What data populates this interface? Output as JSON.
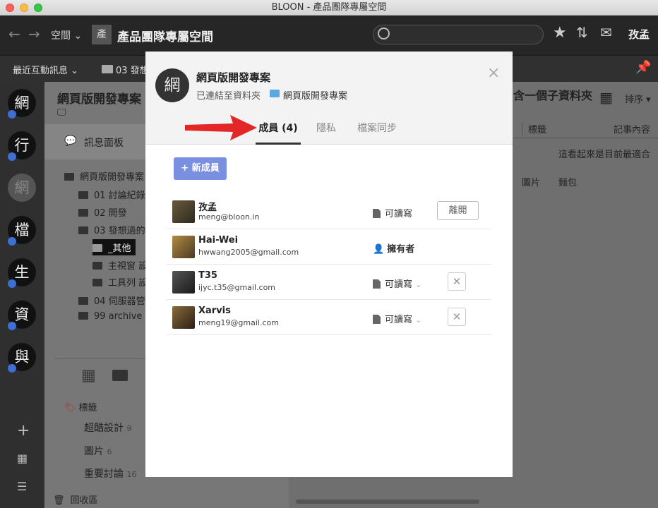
{
  "window": {
    "title": "BLOON - 產品團隊專屬空間"
  },
  "toolbar": {
    "space_label": "空間",
    "space_icon_char": "產",
    "space_name": "產品團隊專屬空間",
    "user": "孜孟"
  },
  "subbar": {
    "recent": "最近互動訊息",
    "folder_crumb": "03 發想"
  },
  "rail": {
    "avatars": [
      "網",
      "行",
      "網",
      "檔",
      "生",
      "資",
      "與"
    ]
  },
  "sidebar": {
    "message_board": "訊息面板",
    "project_title": "網頁版開發專案",
    "tree": [
      "網頁版開發專案",
      "01 討論紀錄",
      "02 開發",
      "03 發想過的",
      "_其他",
      "主視窗 設",
      "工具列 設",
      "04 伺服器管",
      "99 archive"
    ],
    "tags_header": "標籤",
    "tags": [
      {
        "name": "超酷設計",
        "count": "9"
      },
      {
        "name": "圖片",
        "count": "6"
      },
      {
        "name": "重要討論",
        "count": "16"
      }
    ],
    "trash": "回收區"
  },
  "main": {
    "header_partial": "含一個子資料夾",
    "sort_label": "排序",
    "col_tag": "標籤",
    "col_content": "記事內容",
    "row1_content": "這看起來是目前最適合",
    "row2_tag": "圖片",
    "row2_content": "麵包"
  },
  "modal": {
    "avatar_char": "網",
    "title": "網頁版開發專案",
    "linked_label": "已連結至資料夾",
    "linked_folder": "網頁版開發專案",
    "close_icon": "×",
    "tabs": {
      "members": "成員 (4)",
      "privacy": "隱私",
      "sync": "檔案同步"
    },
    "add_member": "+ 新成員",
    "members": [
      {
        "name": "孜孟",
        "email": "meng@bloon.in",
        "perm": "可讀寫",
        "action": "離開"
      },
      {
        "name": "Hai-Wei",
        "email": "hwwang2005@gmail.com",
        "perm": "擁有者"
      },
      {
        "name": "T35",
        "email": "ijyc.t35@gmail.com",
        "perm": "可讀寫"
      },
      {
        "name": "Xarvis",
        "email": "meng19@gmail.com",
        "perm": "可讀寫"
      }
    ]
  },
  "colors": {
    "accent_button": "#7b8fe0",
    "arrow": "#e32626",
    "check_badge": "#3e6fd6"
  }
}
